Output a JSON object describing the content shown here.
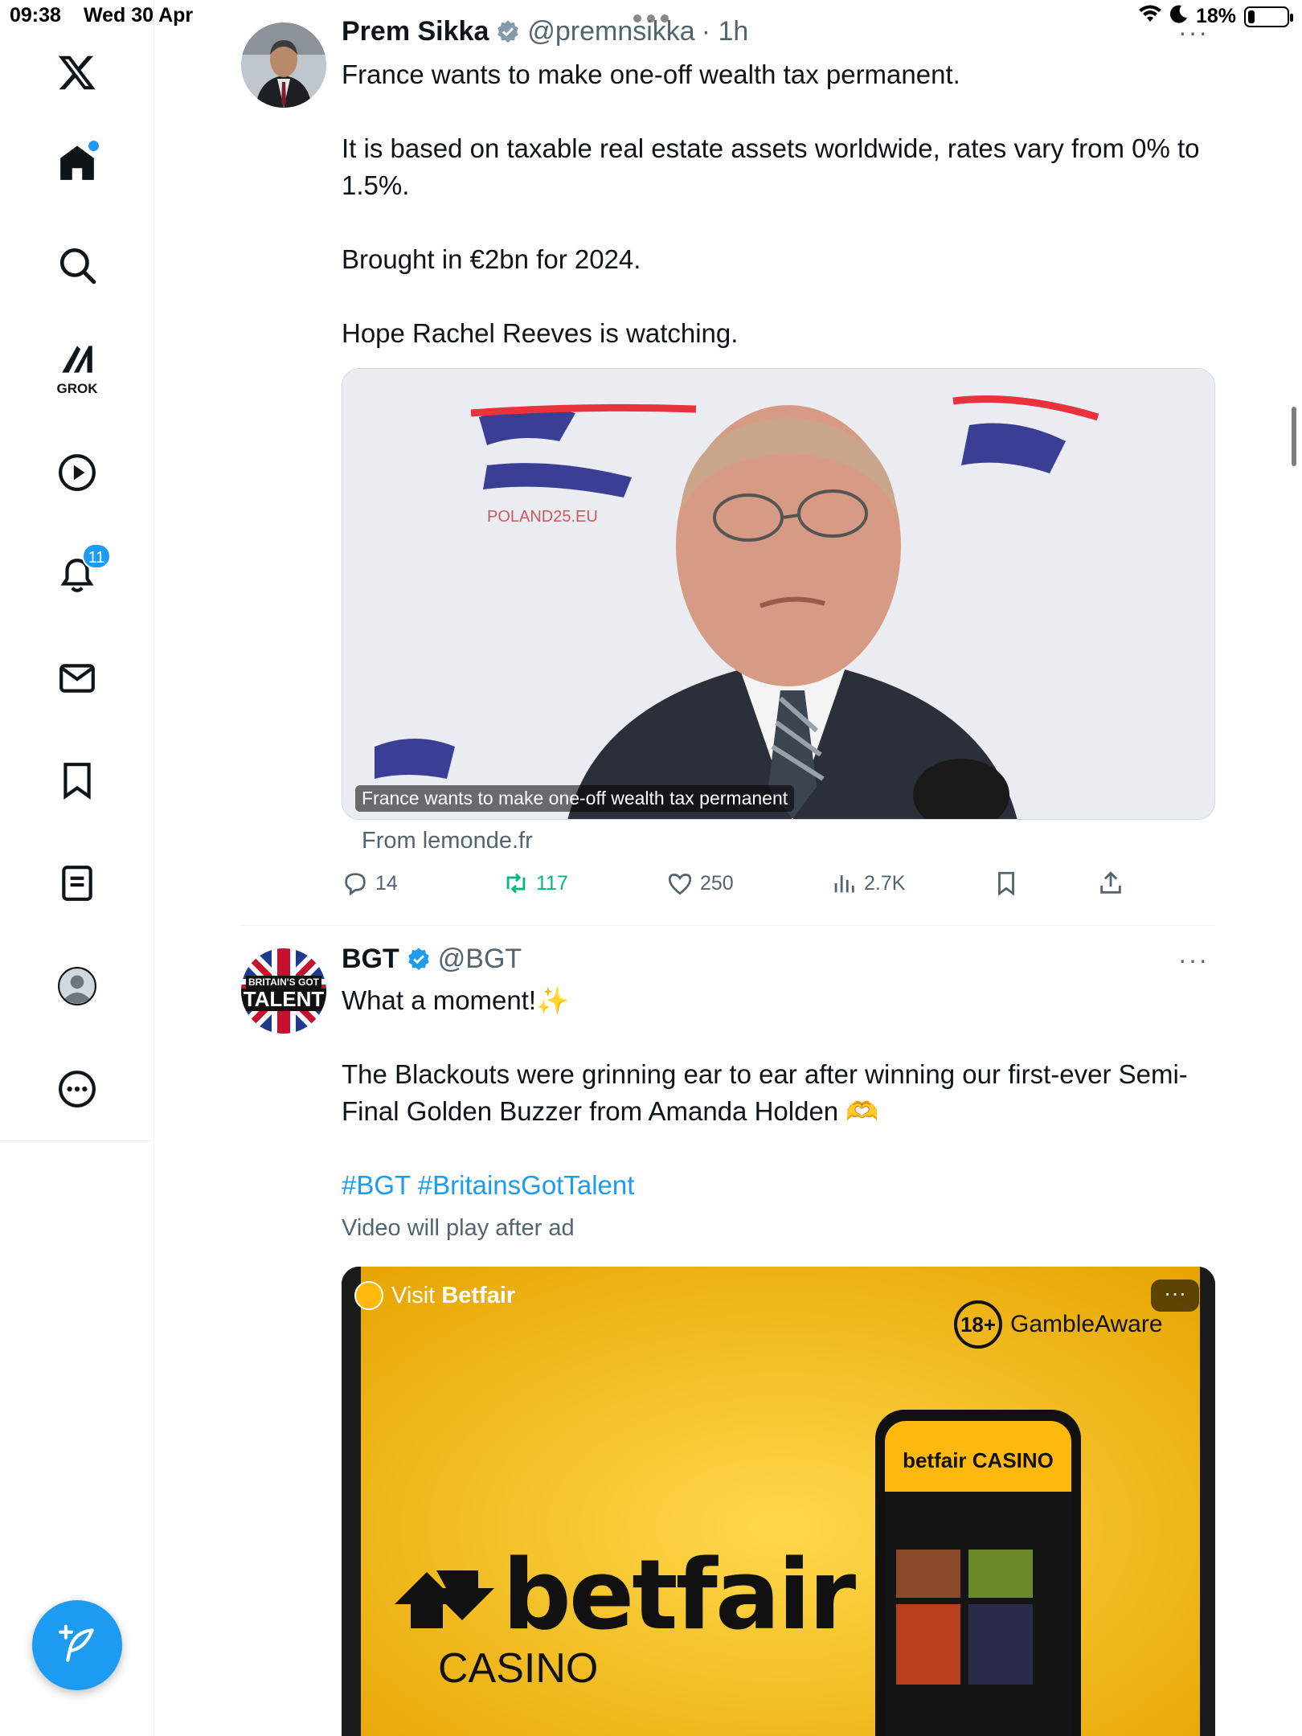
{
  "status_bar": {
    "time": "09:38",
    "date": "Wed 30 Apr",
    "battery": "18%",
    "battery_level": 0.18
  },
  "sidebar": {
    "items": [
      {
        "name": "x-logo",
        "label": ""
      },
      {
        "name": "home",
        "label": ""
      },
      {
        "name": "search",
        "label": ""
      },
      {
        "name": "grok",
        "label": "GROK"
      },
      {
        "name": "video",
        "label": ""
      },
      {
        "name": "notifications",
        "label": "",
        "badge": "11"
      },
      {
        "name": "messages",
        "label": ""
      },
      {
        "name": "bookmarks",
        "label": ""
      },
      {
        "name": "lists",
        "label": ""
      },
      {
        "name": "profile",
        "label": ""
      },
      {
        "name": "more",
        "label": ""
      }
    ]
  },
  "tweets": [
    {
      "name": "Prem Sikka",
      "handle": "@premnsikka",
      "time": "· 1h",
      "text": [
        "France wants to make one-off wealth tax permanent.",
        "It is based on taxable real estate assets worldwide, rates vary from 0% to 1.5%.",
        "Brought in €2bn for 2024.",
        "Hope Rachel Reeves is watching."
      ],
      "card": {
        "caption": "France wants to make one-off wealth tax permanent",
        "source": "From lemonde.fr"
      },
      "actions": {
        "replies": "14",
        "reposts": "117",
        "likes": "250",
        "views": "2.7K"
      }
    },
    {
      "name": "BGT",
      "handle": "@BGT",
      "text_line1": "What a moment!✨",
      "text_line2": "The Blackouts were grinning ear to ear after winning our first-ever Semi-Final Golden Buzzer from Amanda Holden 🫶",
      "hashtags": "#BGT #BritainsGotTalent",
      "video_label": "Video will play after ad",
      "ad": {
        "visit_prefix": "Visit ",
        "visit_brand": "Betfair",
        "age": "18+",
        "gamble_aware": "GambleAware",
        "brand": "betfair",
        "brand_sub": "CASINO",
        "phone_brand": "betfair CASINO"
      }
    }
  ],
  "colors": {
    "accent": "#1d9bf0",
    "repost": "#00ba7c",
    "ad_yellow": "#ffb80c"
  }
}
